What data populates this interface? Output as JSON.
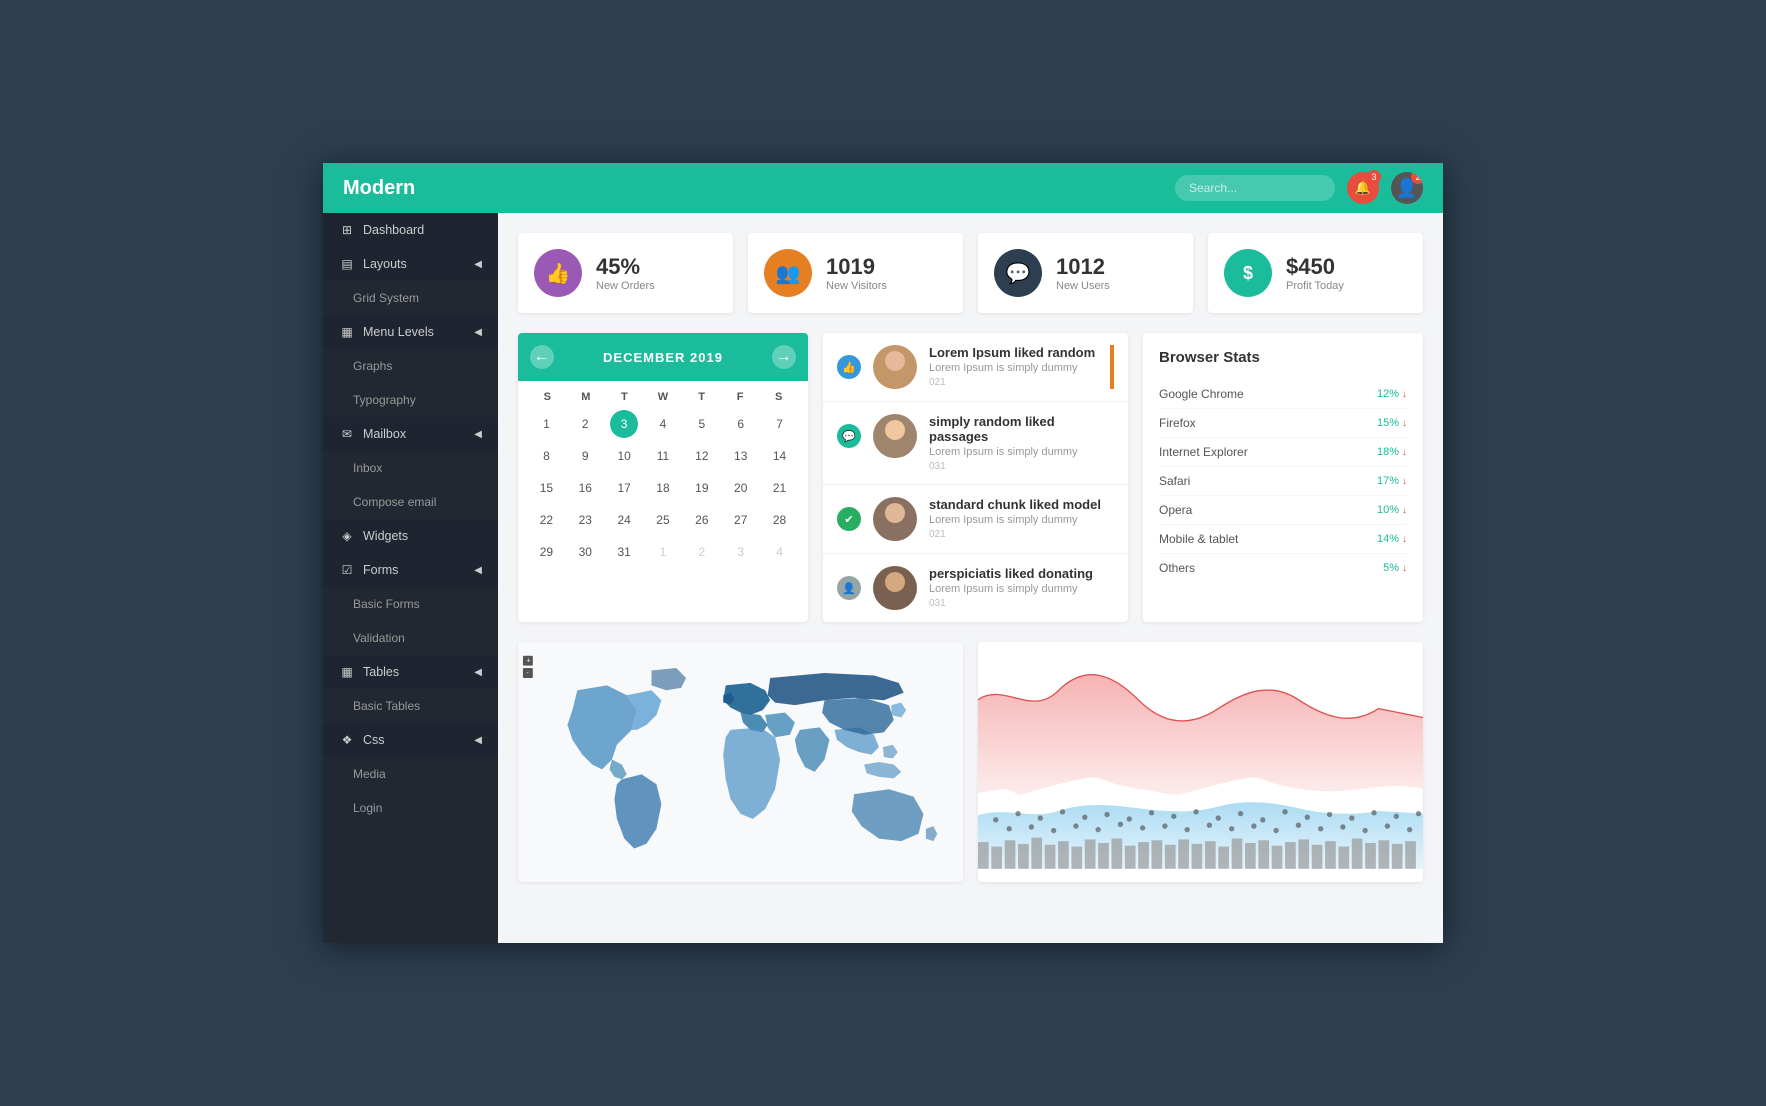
{
  "header": {
    "logo": "Modern",
    "search_placeholder": "Search...",
    "bell_badge": "3",
    "avatar_badge": "2"
  },
  "sidebar": {
    "items": [
      {
        "id": "dashboard",
        "label": "Dashboard",
        "icon": "⊞",
        "type": "section"
      },
      {
        "id": "layouts",
        "label": "Layouts",
        "icon": "▤",
        "type": "section",
        "arrow": "◀"
      },
      {
        "id": "grid-system",
        "label": "Grid System",
        "type": "sub"
      },
      {
        "id": "menu-levels",
        "label": "Menu Levels",
        "icon": "▦",
        "type": "section",
        "arrow": "◀"
      },
      {
        "id": "graphs",
        "label": "Graphs",
        "type": "sub"
      },
      {
        "id": "typography",
        "label": "Typography",
        "type": "sub"
      },
      {
        "id": "mailbox",
        "label": "Mailbox",
        "icon": "✉",
        "type": "section",
        "arrow": "◀"
      },
      {
        "id": "inbox",
        "label": "Inbox",
        "type": "sub"
      },
      {
        "id": "compose",
        "label": "Compose email",
        "type": "sub"
      },
      {
        "id": "widgets",
        "label": "Widgets",
        "icon": "◈",
        "type": "section"
      },
      {
        "id": "forms",
        "label": "Forms",
        "icon": "☑",
        "type": "section",
        "arrow": "◀"
      },
      {
        "id": "basic-forms",
        "label": "Basic Forms",
        "type": "sub"
      },
      {
        "id": "validation",
        "label": "Validation",
        "type": "sub"
      },
      {
        "id": "tables",
        "label": "Tables",
        "icon": "▦",
        "type": "section",
        "arrow": "◀"
      },
      {
        "id": "basic-tables",
        "label": "Basic Tables",
        "type": "sub"
      },
      {
        "id": "css",
        "label": "Css",
        "icon": "❖",
        "type": "section",
        "arrow": "◀"
      },
      {
        "id": "media",
        "label": "Media",
        "type": "sub"
      },
      {
        "id": "login",
        "label": "Login",
        "type": "sub"
      }
    ]
  },
  "stats": [
    {
      "id": "orders",
      "icon": "👍",
      "icon_class": "purple",
      "number": "45%",
      "label": "New Orders"
    },
    {
      "id": "visitors",
      "icon": "👥",
      "icon_class": "orange",
      "number": "1019",
      "label": "New Visitors"
    },
    {
      "id": "users",
      "icon": "💬",
      "icon_class": "navy",
      "number": "1012",
      "label": "New Users"
    },
    {
      "id": "profit",
      "icon": "$",
      "icon_class": "teal",
      "number": "$450",
      "label": "Profit Today"
    }
  ],
  "calendar": {
    "month": "DECEMBER 2019",
    "day_headers": [
      "S",
      "M",
      "T",
      "W",
      "T",
      "F",
      "S"
    ],
    "weeks": [
      [
        {
          "d": "1",
          "m": "cur"
        },
        {
          "d": "2",
          "m": "cur"
        },
        {
          "d": "3",
          "m": "cur",
          "today": true
        },
        {
          "d": "4",
          "m": "cur"
        },
        {
          "d": "5",
          "m": "cur"
        },
        {
          "d": "6",
          "m": "cur"
        },
        {
          "d": "7",
          "m": "cur"
        }
      ],
      [
        {
          "d": "8",
          "m": "cur"
        },
        {
          "d": "9",
          "m": "cur"
        },
        {
          "d": "10",
          "m": "cur"
        },
        {
          "d": "11",
          "m": "cur"
        },
        {
          "d": "12",
          "m": "cur"
        },
        {
          "d": "13",
          "m": "cur"
        },
        {
          "d": "14",
          "m": "cur"
        }
      ],
      [
        {
          "d": "15",
          "m": "cur"
        },
        {
          "d": "16",
          "m": "cur"
        },
        {
          "d": "17",
          "m": "cur"
        },
        {
          "d": "18",
          "m": "cur"
        },
        {
          "d": "19",
          "m": "cur"
        },
        {
          "d": "20",
          "m": "cur"
        },
        {
          "d": "21",
          "m": "cur"
        }
      ],
      [
        {
          "d": "22",
          "m": "cur"
        },
        {
          "d": "23",
          "m": "cur"
        },
        {
          "d": "24",
          "m": "cur"
        },
        {
          "d": "25",
          "m": "cur"
        },
        {
          "d": "26",
          "m": "cur"
        },
        {
          "d": "27",
          "m": "cur"
        },
        {
          "d": "28",
          "m": "cur"
        }
      ],
      [
        {
          "d": "29",
          "m": "cur"
        },
        {
          "d": "30",
          "m": "cur"
        },
        {
          "d": "31",
          "m": "cur"
        },
        {
          "d": "1",
          "m": "next"
        },
        {
          "d": "2",
          "m": "next"
        },
        {
          "d": "3",
          "m": "next"
        },
        {
          "d": "4",
          "m": "next"
        }
      ]
    ]
  },
  "feed": {
    "items": [
      {
        "id": "f1",
        "title": "Lorem Ipsum liked random",
        "text": "Lorem Ipsum is simply dummy",
        "time": "021",
        "action_class": "blue",
        "action_icon": "👍"
      },
      {
        "id": "f2",
        "title": "simply random liked passages",
        "text": "Lorem Ipsum is simply dummy",
        "time": "031",
        "action_class": "teal",
        "action_icon": "💬"
      },
      {
        "id": "f3",
        "title": "standard chunk liked model",
        "text": "Lorem Ipsum is simply dummy",
        "time": "021",
        "action_class": "green",
        "action_icon": "✔"
      },
      {
        "id": "f4",
        "title": "perspiciatis liked donating",
        "text": "Lorem Ipsum is simply dummy",
        "time": "031",
        "action_class": "gray",
        "action_icon": "👤"
      }
    ]
  },
  "browser_stats": {
    "title": "Browser Stats",
    "items": [
      {
        "name": "Google Chrome",
        "pct": "12%"
      },
      {
        "name": "Firefox",
        "pct": "15%"
      },
      {
        "name": "Internet Explorer",
        "pct": "18%"
      },
      {
        "name": "Safari",
        "pct": "17%"
      },
      {
        "name": "Opera",
        "pct": "10%"
      },
      {
        "name": "Mobile & tablet",
        "pct": "14%"
      },
      {
        "name": "Others",
        "pct": "5%"
      }
    ]
  },
  "colors": {
    "accent": "#1abc9c",
    "header_bg": "#1abc9c",
    "sidebar_bg": "#222831",
    "stat_purple": "#9b59b6",
    "stat_orange": "#e67e22",
    "stat_navy": "#2c3e50",
    "stat_teal": "#1abc9c"
  }
}
